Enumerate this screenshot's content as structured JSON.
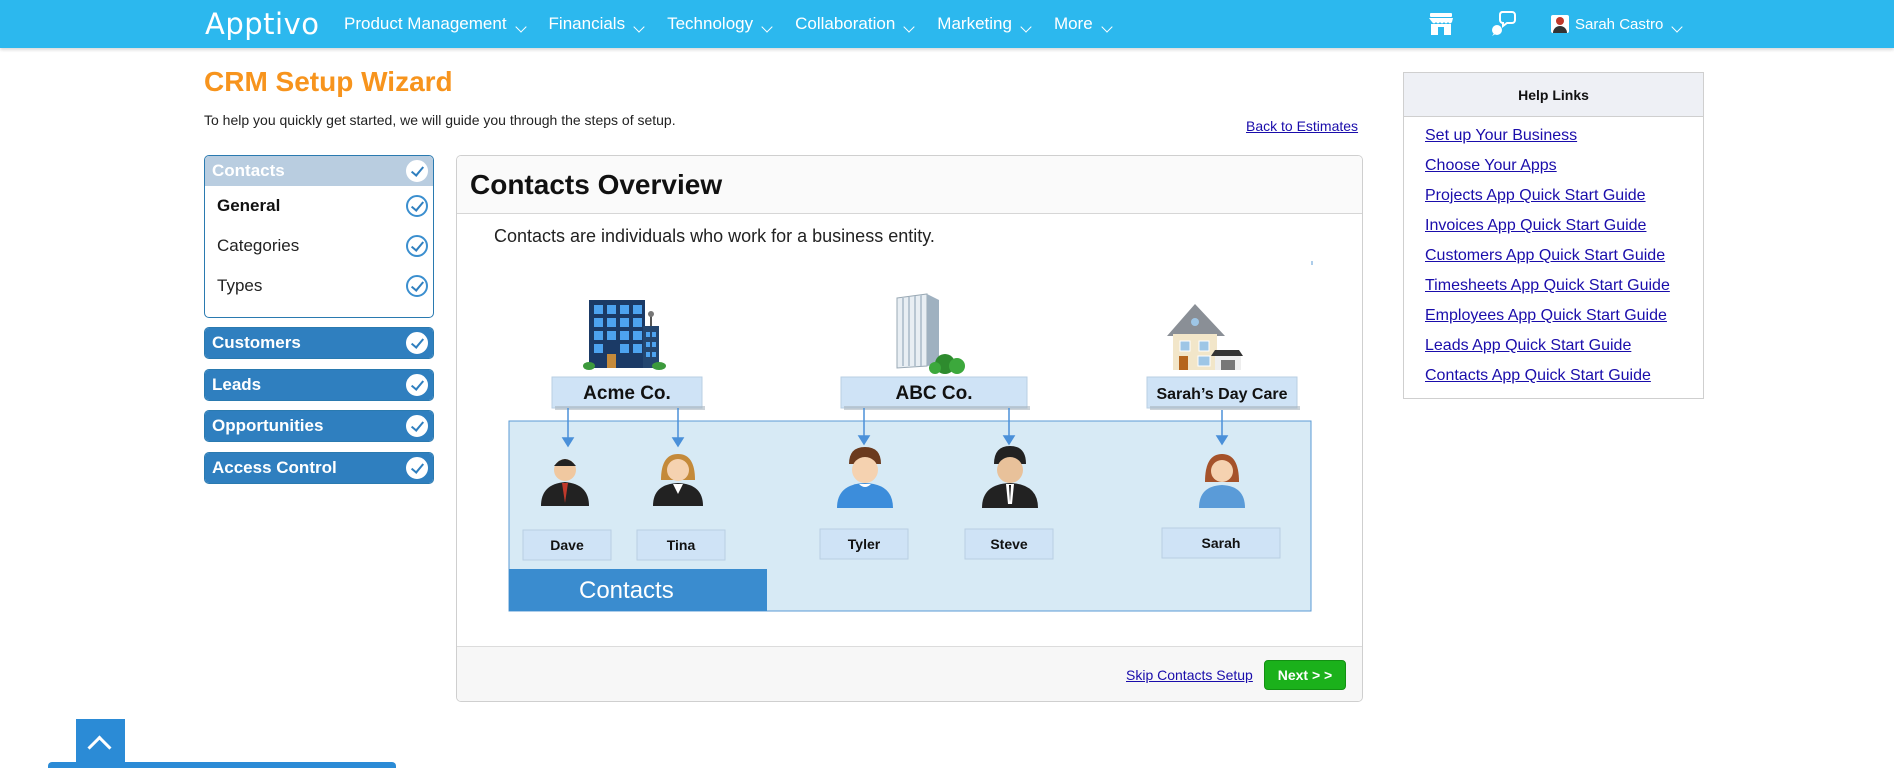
{
  "nav": {
    "logo": "Apptivo",
    "items": [
      "Product Management",
      "Financials",
      "Technology",
      "Collaboration",
      "Marketing",
      "More"
    ],
    "store_icon": "store-icon",
    "chat_icon": "chat-bubble-icon",
    "user_name": "Sarah Castro"
  },
  "page": {
    "title": "CRM Setup Wizard",
    "subtitle": "To help you quickly get started, we will guide you through the steps of setup.",
    "back_link": "Back to Estimates"
  },
  "wizard": {
    "contacts": {
      "label": "Contacts",
      "items": [
        "General",
        "Categories",
        "Types"
      ]
    },
    "sections": [
      "Customers",
      "Leads",
      "Opportunities",
      "Access Control"
    ]
  },
  "panel": {
    "title": "Contacts Overview",
    "description": "Contacts are individuals who work for a business entity.",
    "skip_link": "Skip Contacts Setup",
    "next_label": "Next > >"
  },
  "diagram": {
    "companies": [
      "Acme Co.",
      "ABC Co.",
      "Sarah’s Day Care"
    ],
    "contacts": [
      "Dave",
      "Tina",
      "Tyler",
      "Steve",
      "Sarah"
    ],
    "band_label": "Contacts"
  },
  "help": {
    "title": "Help Links",
    "links": [
      "Set up Your Business",
      "Choose Your Apps",
      "Projects App Quick Start Guide",
      "Invoices App Quick Start Guide",
      "Customers App Quick Start Guide",
      "Timesheets App Quick Start Guide",
      "Employees App Quick Start Guide",
      "Leads App Quick Start Guide",
      "Contacts App Quick Start Guide"
    ]
  },
  "colors": {
    "topbar": "#2cb8ee",
    "title_orange": "#f7941d",
    "nav_blue": "#2f7fbf",
    "next_green": "#1bb11b"
  }
}
